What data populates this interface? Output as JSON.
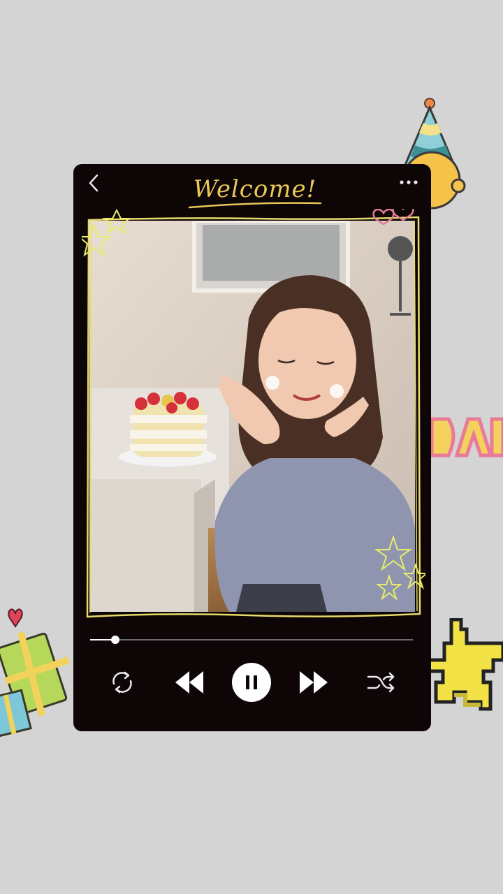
{
  "player": {
    "title": "Welcome!",
    "progress": 0.078
  },
  "icons": {
    "back": "chevron-left-icon",
    "more": "more-horizontal-icon",
    "repeat": "repeat-icon",
    "rewind": "rewind-icon",
    "pause": "pause-icon",
    "forward": "fast-forward-icon",
    "shuffle": "shuffle-icon"
  },
  "colors": {
    "background": "#d4d4d4",
    "player": "#0e0506",
    "title": "#e9c758",
    "frame": "#e6dc6a",
    "star": "#e8ec6a",
    "heart": "#e77a9a"
  }
}
